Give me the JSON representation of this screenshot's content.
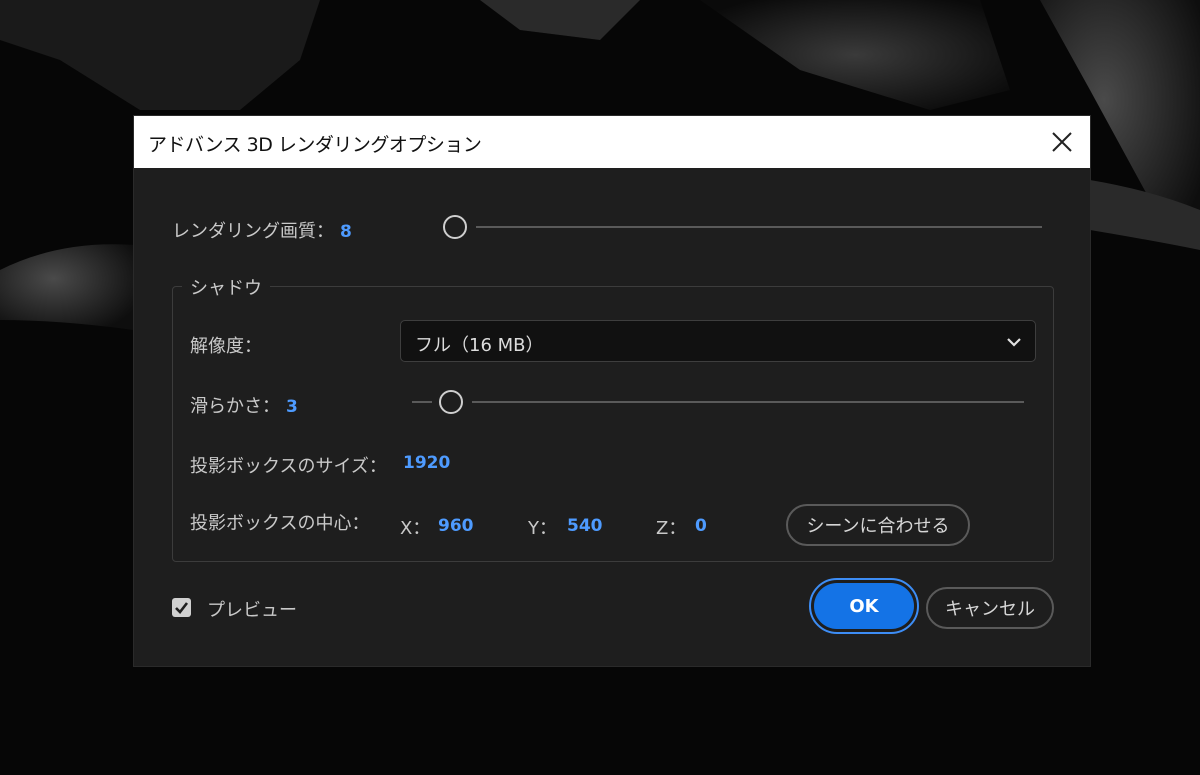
{
  "dialog": {
    "title": "アドバンス 3D レンダリングオプション",
    "close_icon": "close-icon"
  },
  "render_quality": {
    "label": "レンダリング画質：",
    "value": "8",
    "slider_fraction": 0.0
  },
  "shadow": {
    "legend": "シャドウ",
    "resolution": {
      "label": "解像度：",
      "selected": "フル（16 MB）",
      "icon": "chevron-down-icon"
    },
    "smoothness": {
      "label": "滑らかさ：",
      "value": "3"
    },
    "box_size": {
      "label": "投影ボックスのサイズ：",
      "value": "1920"
    },
    "box_center": {
      "label": "投影ボックスの中心：",
      "x_label": "X：",
      "x_value": "960",
      "y_label": "Y：",
      "y_value": "540",
      "z_label": "Z：",
      "z_value": "0",
      "fit_button": "シーンに合わせる"
    }
  },
  "preview": {
    "label": "プレビュー",
    "checked": true
  },
  "buttons": {
    "ok": "OK",
    "cancel": "キャンセル"
  },
  "colors": {
    "accent": "#1473e6",
    "value_text": "#4e9bff",
    "dialog_bg": "#1e1e1e"
  }
}
